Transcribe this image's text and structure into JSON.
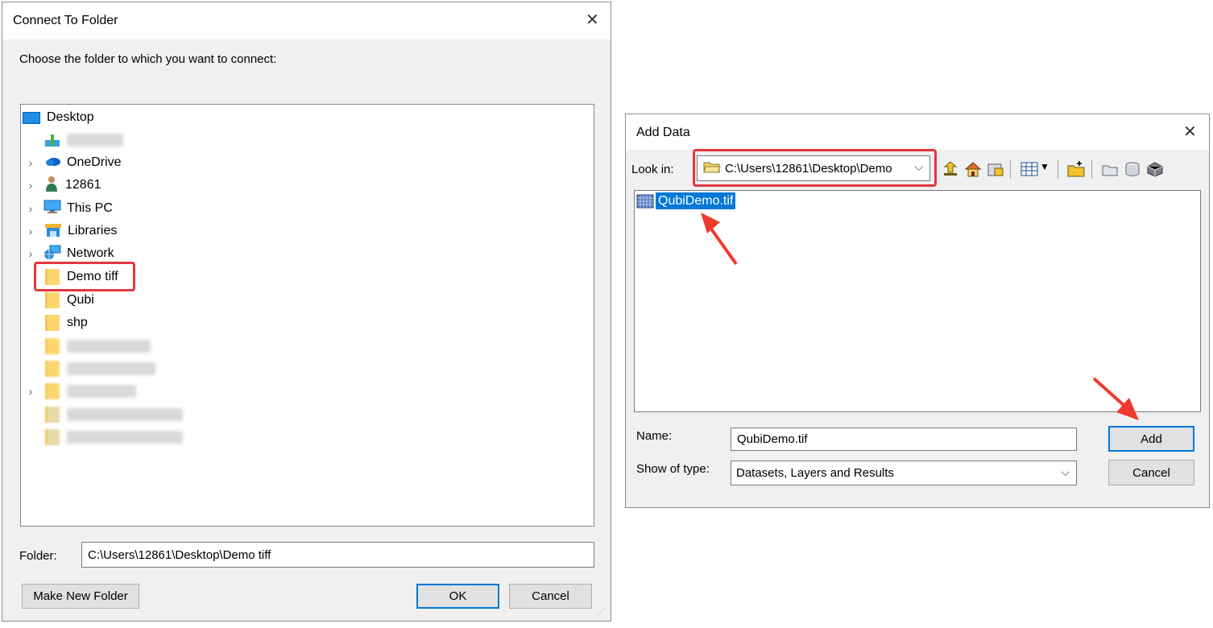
{
  "connect_dialog": {
    "title": "Connect To Folder",
    "prompt": "Choose the folder to which you want to connect:",
    "tree": [
      {
        "label": "Desktop",
        "icon": "desktop-icon"
      },
      {
        "label": "",
        "icon": "user-icon",
        "blurred": true
      },
      {
        "label": "OneDrive",
        "icon": "cloud-icon",
        "expandable": true
      },
      {
        "label": "12861",
        "icon": "person-icon",
        "expandable": true
      },
      {
        "label": "This PC",
        "icon": "computer-icon",
        "expandable": true
      },
      {
        "label": "Libraries",
        "icon": "library-icon",
        "expandable": true
      },
      {
        "label": "Network",
        "icon": "network-icon",
        "expandable": true
      },
      {
        "label": "Demo tiff",
        "icon": "folder-icon",
        "selected": true
      },
      {
        "label": "Qubi",
        "icon": "folder-icon"
      },
      {
        "label": "shp",
        "icon": "folder-icon"
      }
    ],
    "folder_label": "Folder:",
    "folder_value": "C:\\Users\\12861\\Desktop\\Demo tiff",
    "make_new_folder_label": "Make New Folder",
    "ok_label": "OK",
    "cancel_label": "Cancel",
    "highlight_color": "#e0393e",
    "focus_color": "#0078d7"
  },
  "add_data_dialog": {
    "title": "Add Data",
    "look_in_label": "Look in:",
    "look_in_value": "C:\\Users\\12861\\Desktop\\Demo",
    "toolbar_icons": [
      "up-one-level-icon",
      "home-icon",
      "connect-folder-icon",
      "view-list-icon",
      "new-folder-icon",
      "catalog-icon",
      "database-icon",
      "toolbox-icon"
    ],
    "files": [
      {
        "name": "QubiDemo.tif",
        "icon": "raster-icon",
        "selected": true
      }
    ],
    "name_label": "Name:",
    "name_value": "QubiDemo.tif",
    "type_label": "Show of type:",
    "type_value": "Datasets, Layers and Results",
    "add_label": "Add",
    "cancel_label": "Cancel",
    "selection_color": "#0078d7"
  }
}
